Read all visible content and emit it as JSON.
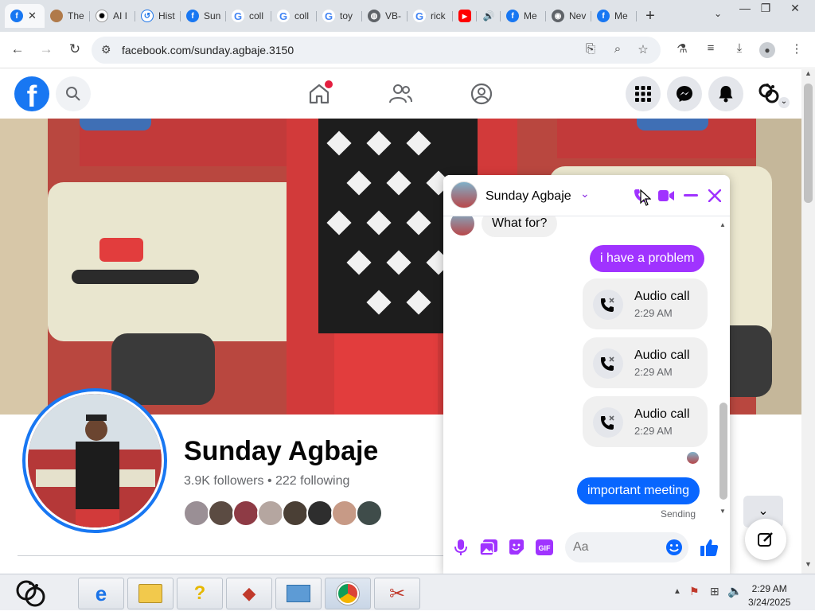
{
  "browser": {
    "tabs": [
      {
        "title": "",
        "icon": "facebook-icon",
        "active": true
      },
      {
        "title": "The",
        "icon": "globe-icon"
      },
      {
        "title": "AI I",
        "icon": "openai-icon"
      },
      {
        "title": "Hist",
        "icon": "history-icon"
      },
      {
        "title": "Sun",
        "icon": "facebook-icon"
      },
      {
        "title": "coll",
        "icon": "google-icon"
      },
      {
        "title": "coll",
        "icon": "google-icon"
      },
      {
        "title": "toy",
        "icon": "google-icon"
      },
      {
        "title": "VB-",
        "icon": "globe-icon"
      },
      {
        "title": "rick",
        "icon": "google-icon"
      },
      {
        "title": "",
        "icon": "youtube-icon"
      },
      {
        "title": "",
        "icon": "audio-icon"
      },
      {
        "title": "Me",
        "icon": "facebook-icon"
      },
      {
        "title": "Nev",
        "icon": "chrome-icon"
      },
      {
        "title": "Me",
        "icon": "facebook-icon"
      }
    ],
    "url": "facebook.com/sunday.agbaje.3150"
  },
  "profile": {
    "name": "Sunday Agbaje",
    "followers_text": "3.9K followers • 222 following"
  },
  "chat": {
    "contact_name": "Sunday Agbaje",
    "messages": {
      "incoming_1": "What for?",
      "outgoing_1": "i have a problem",
      "call_1_title": "Audio call",
      "call_1_time": "2:29 AM",
      "call_2_title": "Audio call",
      "call_2_time": "2:29 AM",
      "call_3_title": "Audio call",
      "call_3_time": "2:29 AM",
      "outgoing_2": "important meeting",
      "status": "Sending"
    },
    "input_placeholder": "Aa"
  },
  "taskbar": {
    "time": "2:29 AM",
    "date": "3/24/2025"
  },
  "colors": {
    "facebook_blue": "#1877f2",
    "messenger_purple": "#a033ff",
    "messenger_blue": "#0866ff"
  }
}
